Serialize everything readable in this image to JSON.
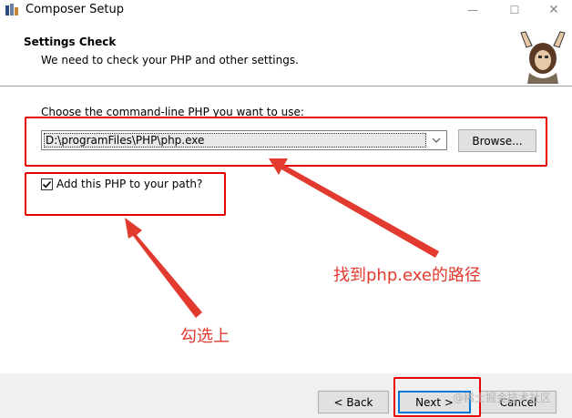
{
  "window": {
    "title": "Composer Setup",
    "minimize_icon": "minimize-icon",
    "maximize_icon": "maximize-icon",
    "close_icon": "close-icon"
  },
  "header": {
    "title": "Settings Check",
    "subtitle": "We need to check your PHP and other settings."
  },
  "main": {
    "choose_label": "Choose the command-line PHP you want to use:",
    "php_path": "D:\\programFiles\\PHP\\php.exe",
    "browse_label": "Browse...",
    "add_path_checked": true,
    "add_path_label": "Add this PHP to your path?"
  },
  "annotations": {
    "find_php": "找到php.exe的路径",
    "check_it": "勾选上",
    "color": "#e60000"
  },
  "footer": {
    "back_label": "< Back",
    "next_label": "Next >",
    "cancel_label": "Cancel"
  },
  "watermark": "@稀土掘金技术社区"
}
